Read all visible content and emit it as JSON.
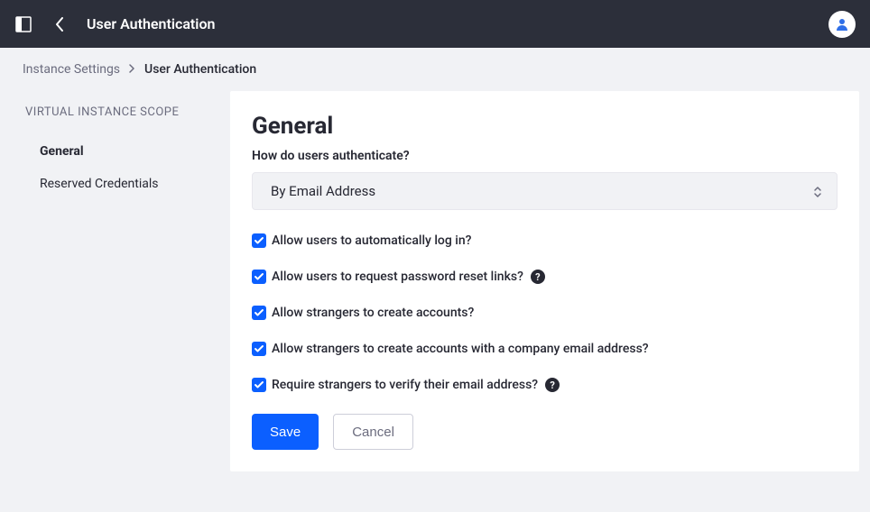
{
  "topbar": {
    "title": "User Authentication"
  },
  "breadcrumb": {
    "parent": "Instance Settings",
    "current": "User Authentication"
  },
  "sidebar": {
    "heading": "Virtual Instance Scope",
    "items": [
      {
        "label": "General",
        "active": true
      },
      {
        "label": "Reserved Credentials",
        "active": false
      }
    ]
  },
  "panel": {
    "title": "General",
    "auth_label": "How do users authenticate?",
    "auth_value": "By Email Address",
    "checks": [
      {
        "label": "Allow users to automatically log in?",
        "checked": true,
        "help": false
      },
      {
        "label": "Allow users to request password reset links?",
        "checked": true,
        "help": true
      },
      {
        "label": "Allow strangers to create accounts?",
        "checked": true,
        "help": false
      },
      {
        "label": "Allow strangers to create accounts with a company email address?",
        "checked": true,
        "help": false
      },
      {
        "label": "Require strangers to verify their email address?",
        "checked": true,
        "help": true
      }
    ],
    "save_label": "Save",
    "cancel_label": "Cancel"
  }
}
